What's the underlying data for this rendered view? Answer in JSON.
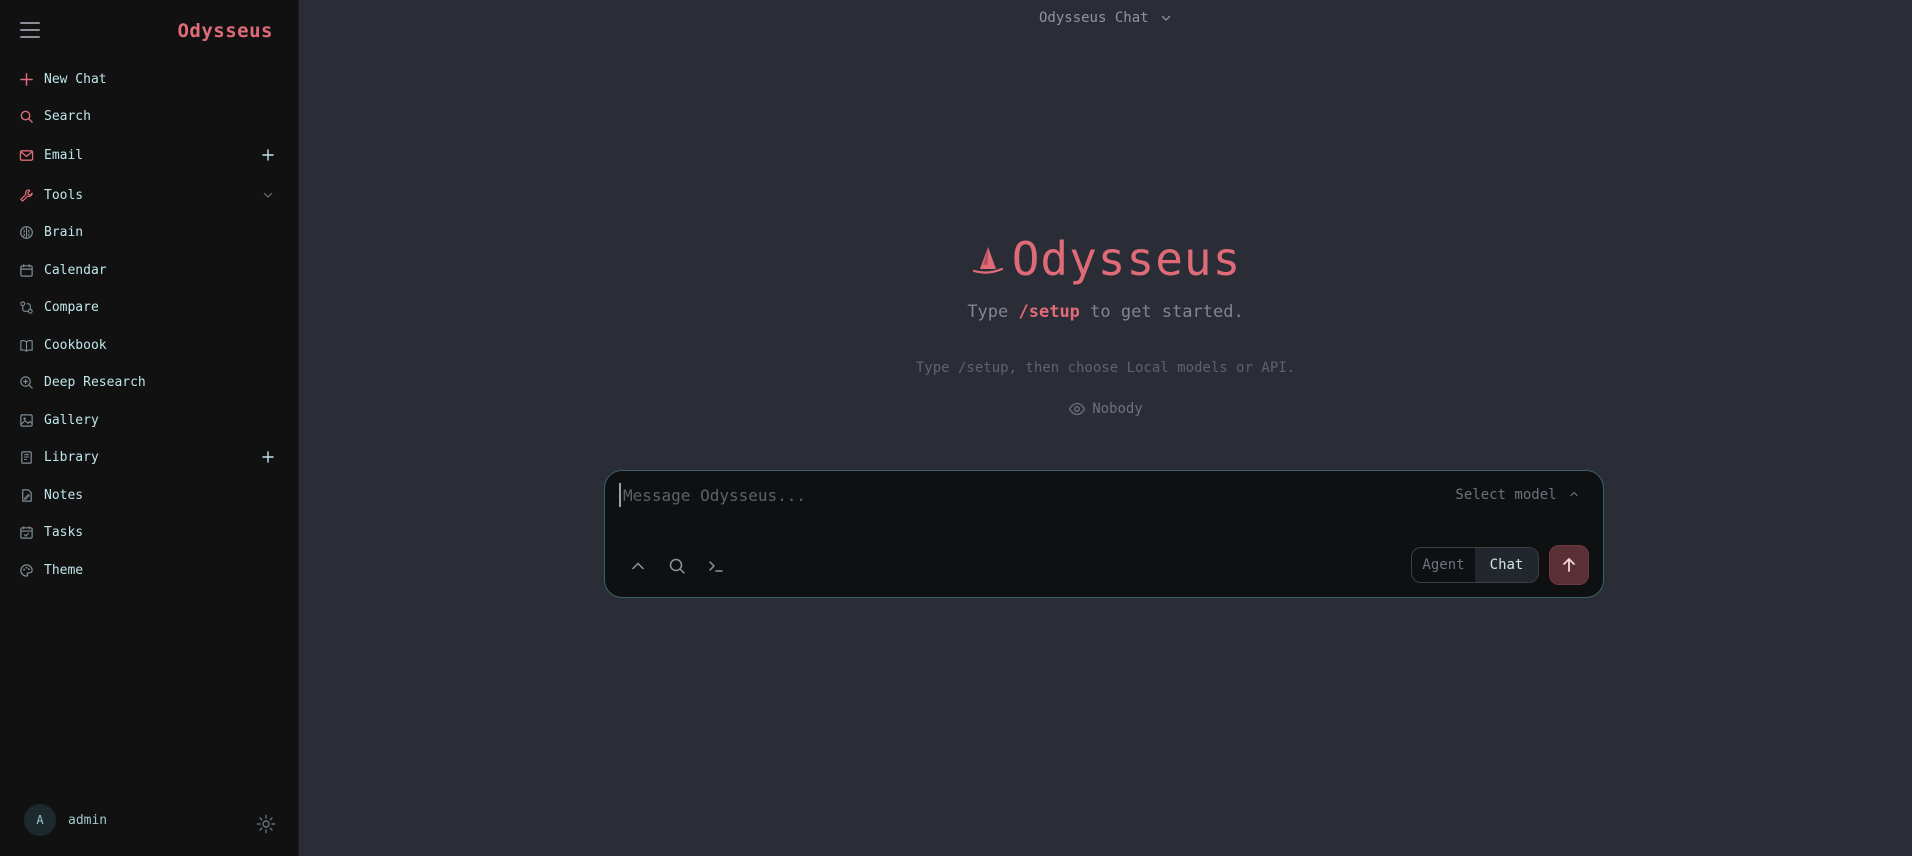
{
  "colors": {
    "accent": "#e06b78",
    "nav_text": "#bfe6ea",
    "sidebar_bg": "#111112",
    "main_bg": "#2a2d35",
    "composer_border": "#3a5f66"
  },
  "sidebar": {
    "brand": "Odysseus",
    "items": [
      {
        "label": "New Chat",
        "icon": "plus-icon"
      },
      {
        "label": "Search",
        "icon": "search-icon"
      },
      {
        "label": "Email",
        "icon": "mail-icon",
        "trailing": "plus-icon"
      },
      {
        "label": "Tools",
        "icon": "wrench-icon",
        "trailing": "chevron-down-icon"
      },
      {
        "label": "Brain",
        "icon": "brain-icon"
      },
      {
        "label": "Calendar",
        "icon": "calendar-icon"
      },
      {
        "label": "Compare",
        "icon": "compare-icon"
      },
      {
        "label": "Cookbook",
        "icon": "book-icon"
      },
      {
        "label": "Deep Research",
        "icon": "research-icon"
      },
      {
        "label": "Gallery",
        "icon": "image-icon"
      },
      {
        "label": "Library",
        "icon": "library-icon",
        "trailing": "plus-icon"
      },
      {
        "label": "Notes",
        "icon": "notes-icon"
      },
      {
        "label": "Tasks",
        "icon": "tasks-icon"
      },
      {
        "label": "Theme",
        "icon": "palette-icon"
      }
    ],
    "user": {
      "initial": "A",
      "name": "admin"
    }
  },
  "topbar": {
    "title": "Odysseus Chat"
  },
  "hero": {
    "title": "Odysseus",
    "sub_prefix": "Type ",
    "sub_cmd": "/setup",
    "sub_suffix": " to get started.",
    "hint": "Type /setup, then choose Local models or API.",
    "visibility": "Nobody"
  },
  "composer": {
    "placeholder": "Message Odysseus...",
    "value": "",
    "model_select": "Select model",
    "modes": [
      "Agent",
      "Chat"
    ],
    "active_mode": "Chat"
  }
}
